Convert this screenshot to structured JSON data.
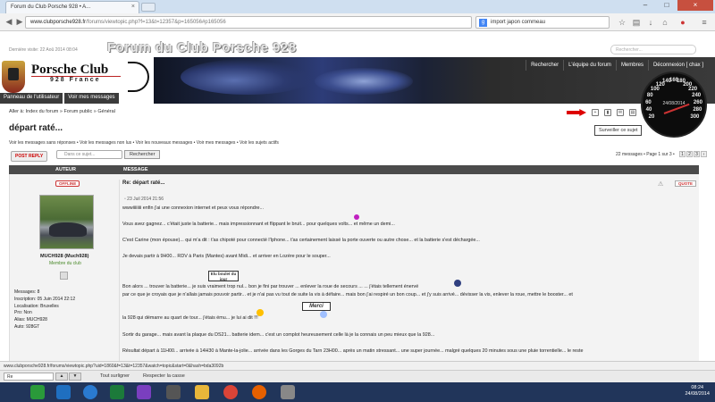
{
  "browser": {
    "tab_title": "Forum du Club Porsche 928 • A...",
    "url_host": "www.clubporsche928.fr",
    "url_path": "/forums/viewtopic.php?f=13&t=12357&p=165056#p165056",
    "search_value": "import japon commeau"
  },
  "header": {
    "last_visit": "Dernière visite: 22 Aoû 2014 08:04",
    "forum_title": "Forum du Club Porsche 928",
    "search_placeholder": "Rechercher...",
    "logo_title": "Porsche Club",
    "logo_sub": "928 France",
    "user_panel": "Panneau de l'utilisateur",
    "messages": "Voir mes messages",
    "menu": [
      "Rechercher",
      "L'équipe du forum",
      "Membres",
      "Déconnexion [ chax ]"
    ],
    "gauge_date": "24/08/2014",
    "gauge_numbers": [
      "20",
      "40",
      "60",
      "80",
      "100",
      "120",
      "140",
      "160",
      "180",
      "200",
      "220",
      "240",
      "260",
      "280",
      "300"
    ]
  },
  "breadcrumb": "Aller à: Index du forum » Forum public » Général",
  "tooltip": "Surveiller ce sujet",
  "topic_title": "départ raté...",
  "quick_links": "Voir les messages sans réponses • Voir les messages non lus • Voir les nouveaux messages • Voir mes messages • Voir les sujets actifs",
  "post_reply": "POST REPLY",
  "topic_search_placeholder": "Dans ce sujet...",
  "search_button": "Rechercher",
  "pagination": "22 messages • Page 1 sur 3 •",
  "pages": [
    "1",
    "2",
    "3"
  ],
  "table": {
    "author": "AUTEUR",
    "message": "MESSAGE"
  },
  "post": {
    "status": "OFFLINE",
    "username": "MUCH928 (Much928)",
    "rank": "Membre du club",
    "profile": [
      "Messages: 8",
      "Inscription: 05 Juin 2014 22:12",
      "Localisation: Bruxelles",
      "Pro: Non",
      "Alias: MUCH928",
      "Auto: 928GT"
    ],
    "title": "Re: départ raté...",
    "quote": "QUOTE",
    "date": "23 Juil 2014 21:56",
    "lines": [
      "wwwiiiiiiii enfin j'ai une connexion internet et peux vous répondre...",
      "Vous avez gagnez... c'était juste la batterie... mais impressionnant et flippant le bruit... pour quelques volts... et même un demi...",
      "C'est Carine (mon épouse)... qui m'a dit : t'as chipoté pour connecté l'Iphone... t'as certainement laissé la porte ouverte ou autre chose... et la batterie s'est déchargée...",
      "Je devais partir à 9H00... RDV à Paris (Mantes) avant Midi... et arriver en Lozère pour le souper...",
      "Bon alors ... trouver la batterie...                 je suis vraiment trop nul... bon je fini par trouver ... enlever la roue de secours ...       ... j'étais tellement énervé",
      "par ce que je croyais que je n'allais jamais pouvoir partir... et je n'ai pas vu tout de suite la vis à défaire...  mais bon j'ai respiré un bon coup... et j'y suis arrivé...   dévisser la vis, enlever la roue, mettre le booster... et",
      "la 928 qui démarre au quart de tour... j'étais ému...       je lui ai dit               !!!",
      "Sortir du garage... mais avant la plaque du DS21... batterie idem... c'est un complot heureusement celle là je la connais un peu mieux que la 928...",
      "Résultat départ à 11H00... arrivée à 14H30 à Mante-la-jolie... arrivée dans les Gorges du Tarn 23H00... après un matin stressant... une super journée... malgré quelques 20 minutes sous une pluie torrentielle... le reste"
    ],
    "sign_boulet": "Elu boulet du jour",
    "sign_merci": "Merci"
  },
  "statusbar": "www.clubporsche928.fr/forums/viewtopic.php?uid=1860&f=13&t=12357&watch=topic&start=0&hash=bda3092b",
  "findbar": {
    "value": "Re",
    "highlight": "Tout surligner",
    "case": "Respecter la casse"
  },
  "clock": {
    "time": "08:24",
    "date": "24/08/2014"
  },
  "colors": {
    "header_dark": "#3b3b3b",
    "table_head": "#4b4b4b",
    "taskbar": "#21355a",
    "offline": "#cc3333"
  }
}
